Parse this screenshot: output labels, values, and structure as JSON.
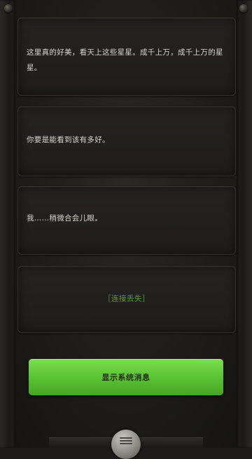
{
  "messages": [
    {
      "text": "这里真的好美，看天上这些星星。成千上万，成千上万的星星。"
    },
    {
      "text": "你要是能看到该有多好。"
    },
    {
      "text": "我……稍微合会儿眼。"
    }
  ],
  "status": {
    "connection_lost": "［连接丢失］"
  },
  "action_button": {
    "label": "显示系统消息"
  },
  "colors": {
    "accent_green": "#5cc635",
    "status_green": "#5d9a3f",
    "panel_bg": "#1e1d1a",
    "text": "#d9d6cf"
  },
  "icons": {
    "menu": "menu-icon"
  }
}
